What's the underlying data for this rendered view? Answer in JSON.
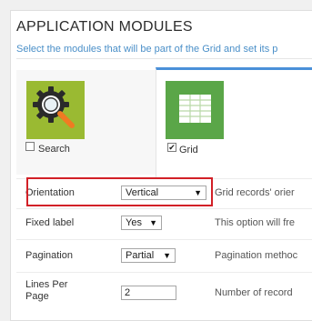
{
  "header": {
    "title": "APPLICATION MODULES",
    "subtitle": "Select the modules that will be part of the Grid and set its p"
  },
  "modules": [
    {
      "label": "Search",
      "checked": false,
      "icon": "search-magnifier-icon",
      "color": "#9aba32"
    },
    {
      "label": "Grid",
      "checked": true,
      "icon": "grid-table-icon",
      "color": "#5aa648"
    }
  ],
  "settings": {
    "orientation": {
      "label": "Orientation",
      "value": "Vertical",
      "description": "Grid records' orier"
    },
    "fixed_label": {
      "label": "Fixed label",
      "value": "Yes",
      "description": "This option will fre"
    },
    "pagination": {
      "label": "Pagination",
      "value": "Partial",
      "description": "Pagination methoc"
    },
    "lines_per_page": {
      "label": "Lines Per Page",
      "value": "2",
      "description": "Number of record"
    }
  },
  "colors": {
    "accent": "#4a90d9",
    "highlight": "#d22027",
    "subtitle": "#4a8fc8"
  }
}
